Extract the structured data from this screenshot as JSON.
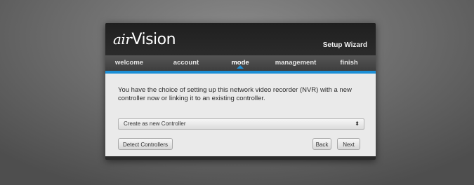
{
  "app": {
    "logo_prefix": "air",
    "logo_name": "Vision",
    "wizard_title": "Setup Wizard"
  },
  "nav": {
    "items": [
      {
        "label": "welcome",
        "active": false
      },
      {
        "label": "account",
        "active": false
      },
      {
        "label": "mode",
        "active": true
      },
      {
        "label": "management",
        "active": false
      },
      {
        "label": "finish",
        "active": false
      }
    ],
    "accent_color": "#1c8fd6"
  },
  "main": {
    "intro_text": "You have the choice of setting up this network video recorder (NVR) with a new controller now or linking it to an existing controller.",
    "mode_select": {
      "selected": "Create as new Controller",
      "arrow_icon": "up-down-caret-icon"
    },
    "buttons": {
      "detect": "Detect Controllers",
      "back": "Back",
      "next": "Next"
    }
  }
}
